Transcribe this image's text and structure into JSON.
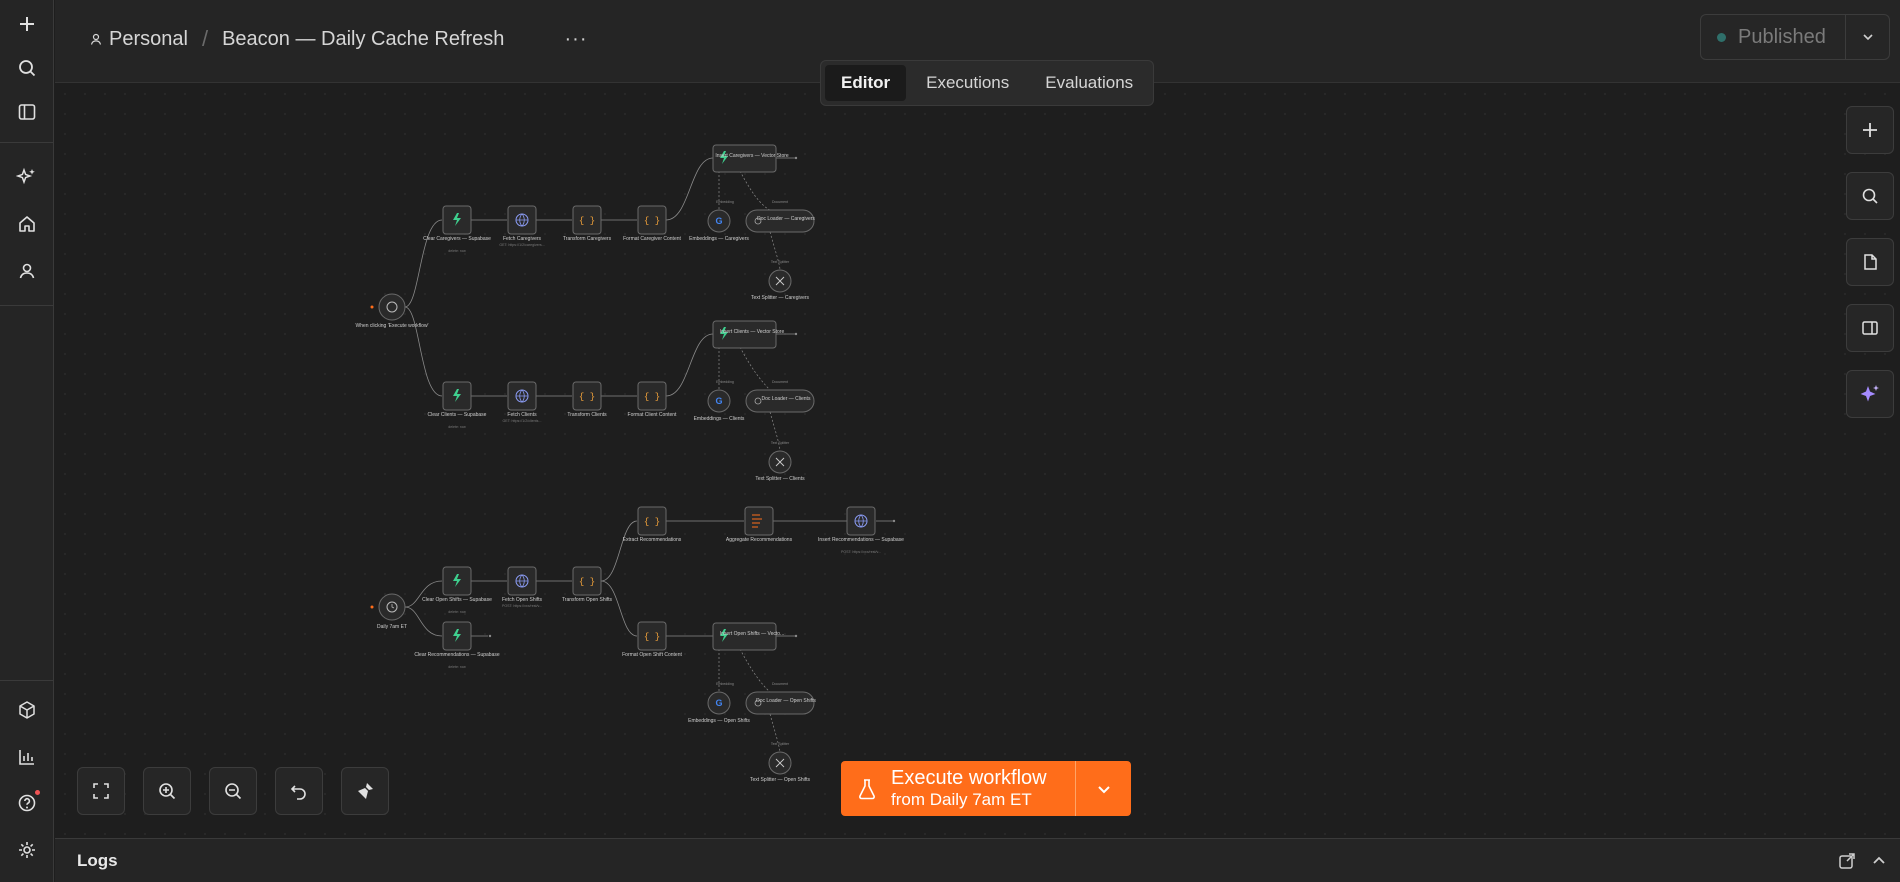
{
  "header": {
    "workspace": "Personal",
    "workflow_name": "Beacon — Daily Cache Refresh",
    "more_label": "···",
    "publish_label": "Published"
  },
  "tabs": [
    {
      "label": "Editor",
      "active": true
    },
    {
      "label": "Executions",
      "active": false
    },
    {
      "label": "Evaluations",
      "active": false
    }
  ],
  "execute": {
    "line1": "Execute workflow",
    "line2": "from Daily 7am ET"
  },
  "logs": {
    "title": "Logs"
  },
  "colors": {
    "accent": "#ff6d1a",
    "published_dot": "#2f6f6a",
    "notification": "#f05454"
  },
  "sidebar_icons": [
    "plus-icon",
    "search-icon",
    "panel-icon",
    "sparkle-icon",
    "home-icon",
    "user-icon",
    "cube-icon",
    "chart-icon",
    "help-icon",
    "gear-icon"
  ],
  "nodes": {
    "trigger_manual": "When clicking 'Execute workflow'",
    "clear_caregivers": "Clear Caregivers — Supabase",
    "clear_caregivers_sub": "delete: row",
    "fetch_caregivers": "Fetch Caregivers",
    "fetch_caregivers_sub": "GET: https://1/2/caregivers...",
    "transform_caregivers": "Transform Caregivers",
    "format_caregiver": "Format Caregiver Content",
    "insert_caregivers": "Insert Caregivers — Vector Store",
    "emb_caregivers": "Embeddings — Caregivers",
    "doc_caregivers": "Doc Loader — Caregivers",
    "split_caregivers": "Text Splitter — Caregivers",
    "clear_clients": "Clear Clients — Supabase",
    "clear_clients_sub": "delete: row",
    "fetch_clients": "Fetch Clients",
    "fetch_clients_sub": "GET: https://1/2/clients...",
    "transform_clients": "Transform Clients",
    "format_client": "Format Client Content",
    "insert_clients": "Insert Clients — Vector Store",
    "emb_clients": "Embeddings — Clients",
    "doc_clients": "Doc Loader — Clients",
    "split_clients": "Text Splitter — Clients",
    "extract_recs": "Extract Recommendations",
    "aggregate_recs": "Aggregate Recommendations",
    "insert_recs": "Insert Recommendations — Supabase",
    "insert_recs_sub": "POST: https://xxx/rest/v...",
    "trigger_daily": "Daily 7am ET",
    "clear_open_shifts": "Clear Open Shifts — Supabase",
    "clear_open_shifts_sub": "delete: row",
    "fetch_open_shifts": "Fetch Open Shifts",
    "fetch_open_shifts_sub": "POST: https://xxx/rest/v...",
    "transform_open_shifts": "Transform Open Shifts",
    "clear_recs": "Clear Recommendations — Supabase",
    "clear_recs_sub": "delete: row",
    "format_open_shift": "Format Open Shift Content",
    "insert_open_shifts": "Insert Open Shifts — Vecto...",
    "emb_open_shifts": "Embeddings — Open Shifts",
    "doc_open_shifts": "Doc Loader — Open Shifts",
    "split_open_shifts": "Text Splitter — Open Shifts",
    "port_embedding": "Embedding",
    "port_document": "Document",
    "port_text_splitter": "Text Splitter"
  }
}
